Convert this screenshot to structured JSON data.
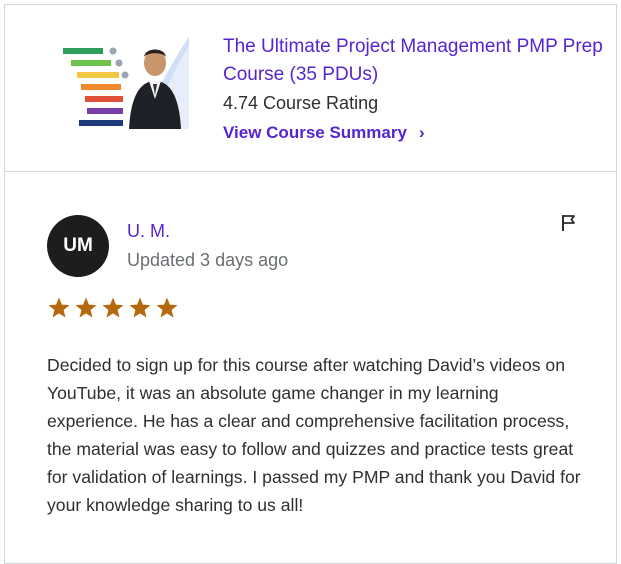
{
  "course": {
    "thumbnail_icon": "pmp-course-thumbnail",
    "title": "The Ultimate Project Management PMP Prep Course (35 PDUs)",
    "rating": "4.74 Course Rating",
    "summary_link": "View Course Summary",
    "summary_chevron": "›"
  },
  "review": {
    "avatar_initials": "UM",
    "reviewer_name": "U. M.",
    "updated": "Updated 3 days ago",
    "flag_icon": "flag-icon",
    "stars": 5,
    "star_color": "#b4690e",
    "text": "Decided to sign up for this course after watching David’s videos on YouTube, it was an absolute game changer in my learning experience. He has a clear and comprehensive facilitation process, the material was easy to follow and quizzes and practice tests great for validation of learnings. I passed my PMP and thank you David for your knowledge sharing to us all!"
  },
  "colors": {
    "link_purple": "#5624d0",
    "text_dark": "#2d2f31",
    "text_muted": "#6a6f73",
    "border": "#d1d7dc"
  }
}
